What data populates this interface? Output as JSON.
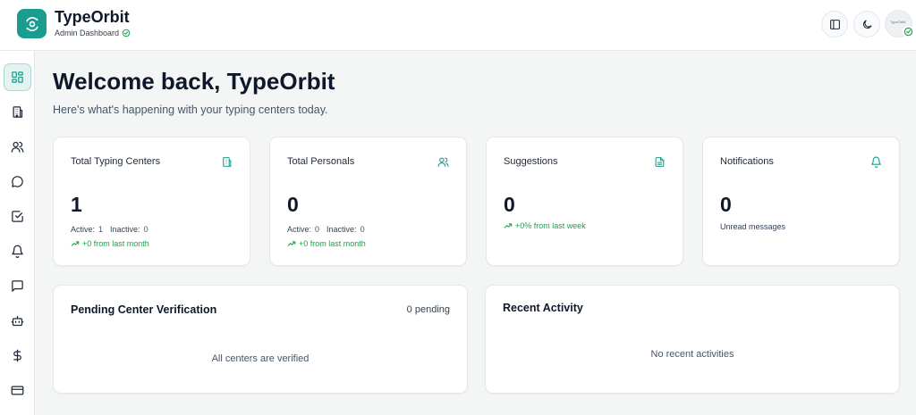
{
  "app": {
    "name": "TypeOrbit",
    "subtitle": "Admin Dashboard"
  },
  "header": {
    "avatar_text": "TypeOrbit"
  },
  "sidebar": {
    "items": [
      "dashboard",
      "typing-centers",
      "personals",
      "suggestions",
      "tasks",
      "notifications",
      "messages",
      "bot",
      "billing",
      "payments"
    ]
  },
  "main": {
    "welcome": "Welcome back, TypeOrbit",
    "subtitle": "Here's what's happening with your typing centers today.",
    "stats": [
      {
        "title": "Total Typing Centers",
        "value": "1",
        "active_label": "Active:",
        "active": "1",
        "inactive_label": "Inactive:",
        "inactive": "0",
        "trend": "+0 from last month",
        "icon": "building-icon"
      },
      {
        "title": "Total Personals",
        "value": "0",
        "active_label": "Active:",
        "active": "0",
        "inactive_label": "Inactive:",
        "inactive": "0",
        "trend": "+0 from last month",
        "icon": "users-icon"
      },
      {
        "title": "Suggestions",
        "value": "0",
        "trend": "+0% from last week",
        "icon": "file-text-icon"
      },
      {
        "title": "Notifications",
        "value": "0",
        "note": "Unread messages",
        "icon": "bell-icon"
      }
    ],
    "pending": {
      "title": "Pending Center Verification",
      "count": "0 pending",
      "empty": "All centers are verified"
    },
    "activity": {
      "title": "Recent Activity",
      "empty": "No recent activities"
    }
  },
  "colors": {
    "accent": "#1a9c8f",
    "trend": "#16a34a",
    "background": "#f3f6f5"
  }
}
